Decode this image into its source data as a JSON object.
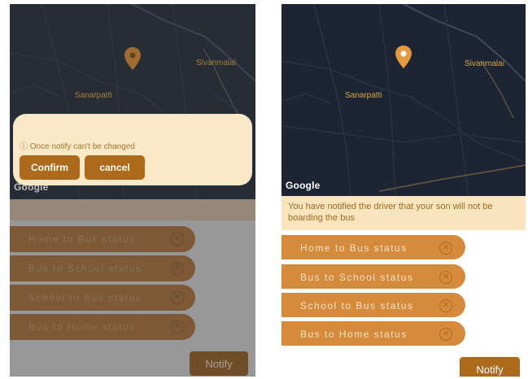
{
  "left_screen": {
    "map": {
      "place_label_1": "Sanarpatti",
      "place_label_2": "Sivanmalai",
      "attribution": "Google",
      "pin_icon": "map-pin-icon"
    },
    "dialog": {
      "info_icon": "info-icon",
      "message": "ⓘ Once notify can't be changed",
      "confirm_label": "Confirm",
      "cancel_label": "cancel"
    },
    "status_items": [
      {
        "label": "Home to Bus status",
        "icon": "close-circle-icon"
      },
      {
        "label": "Bus to School status",
        "icon": "close-circle-icon"
      },
      {
        "label": "School to Bus status",
        "icon": "close-circle-icon"
      },
      {
        "label": "Bus to Home status",
        "icon": "close-circle-icon"
      }
    ],
    "notify_label": "Notify"
  },
  "right_screen": {
    "map": {
      "place_label_1": "Sanarpatti",
      "place_label_2": "Sivanmalai",
      "attribution": "Google",
      "pin_icon": "map-pin-icon"
    },
    "notice": "You have notified the driver that your son will not be boarding the bus",
    "status_items": [
      {
        "label": "Home to Bus status",
        "icon": "close-circle-icon"
      },
      {
        "label": "Bus to School status",
        "icon": "close-circle-icon"
      },
      {
        "label": "School to Bus status",
        "icon": "close-circle-icon"
      },
      {
        "label": "Bus to Home status",
        "icon": "close-circle-icon"
      }
    ],
    "notify_label": "Notify"
  },
  "colors": {
    "map_bg": "#1d2533",
    "accent": "#ad6a1c",
    "status_pill": "#d58a3c",
    "dialog_bg": "#fbe8c6",
    "label_text": "#d9a441"
  }
}
